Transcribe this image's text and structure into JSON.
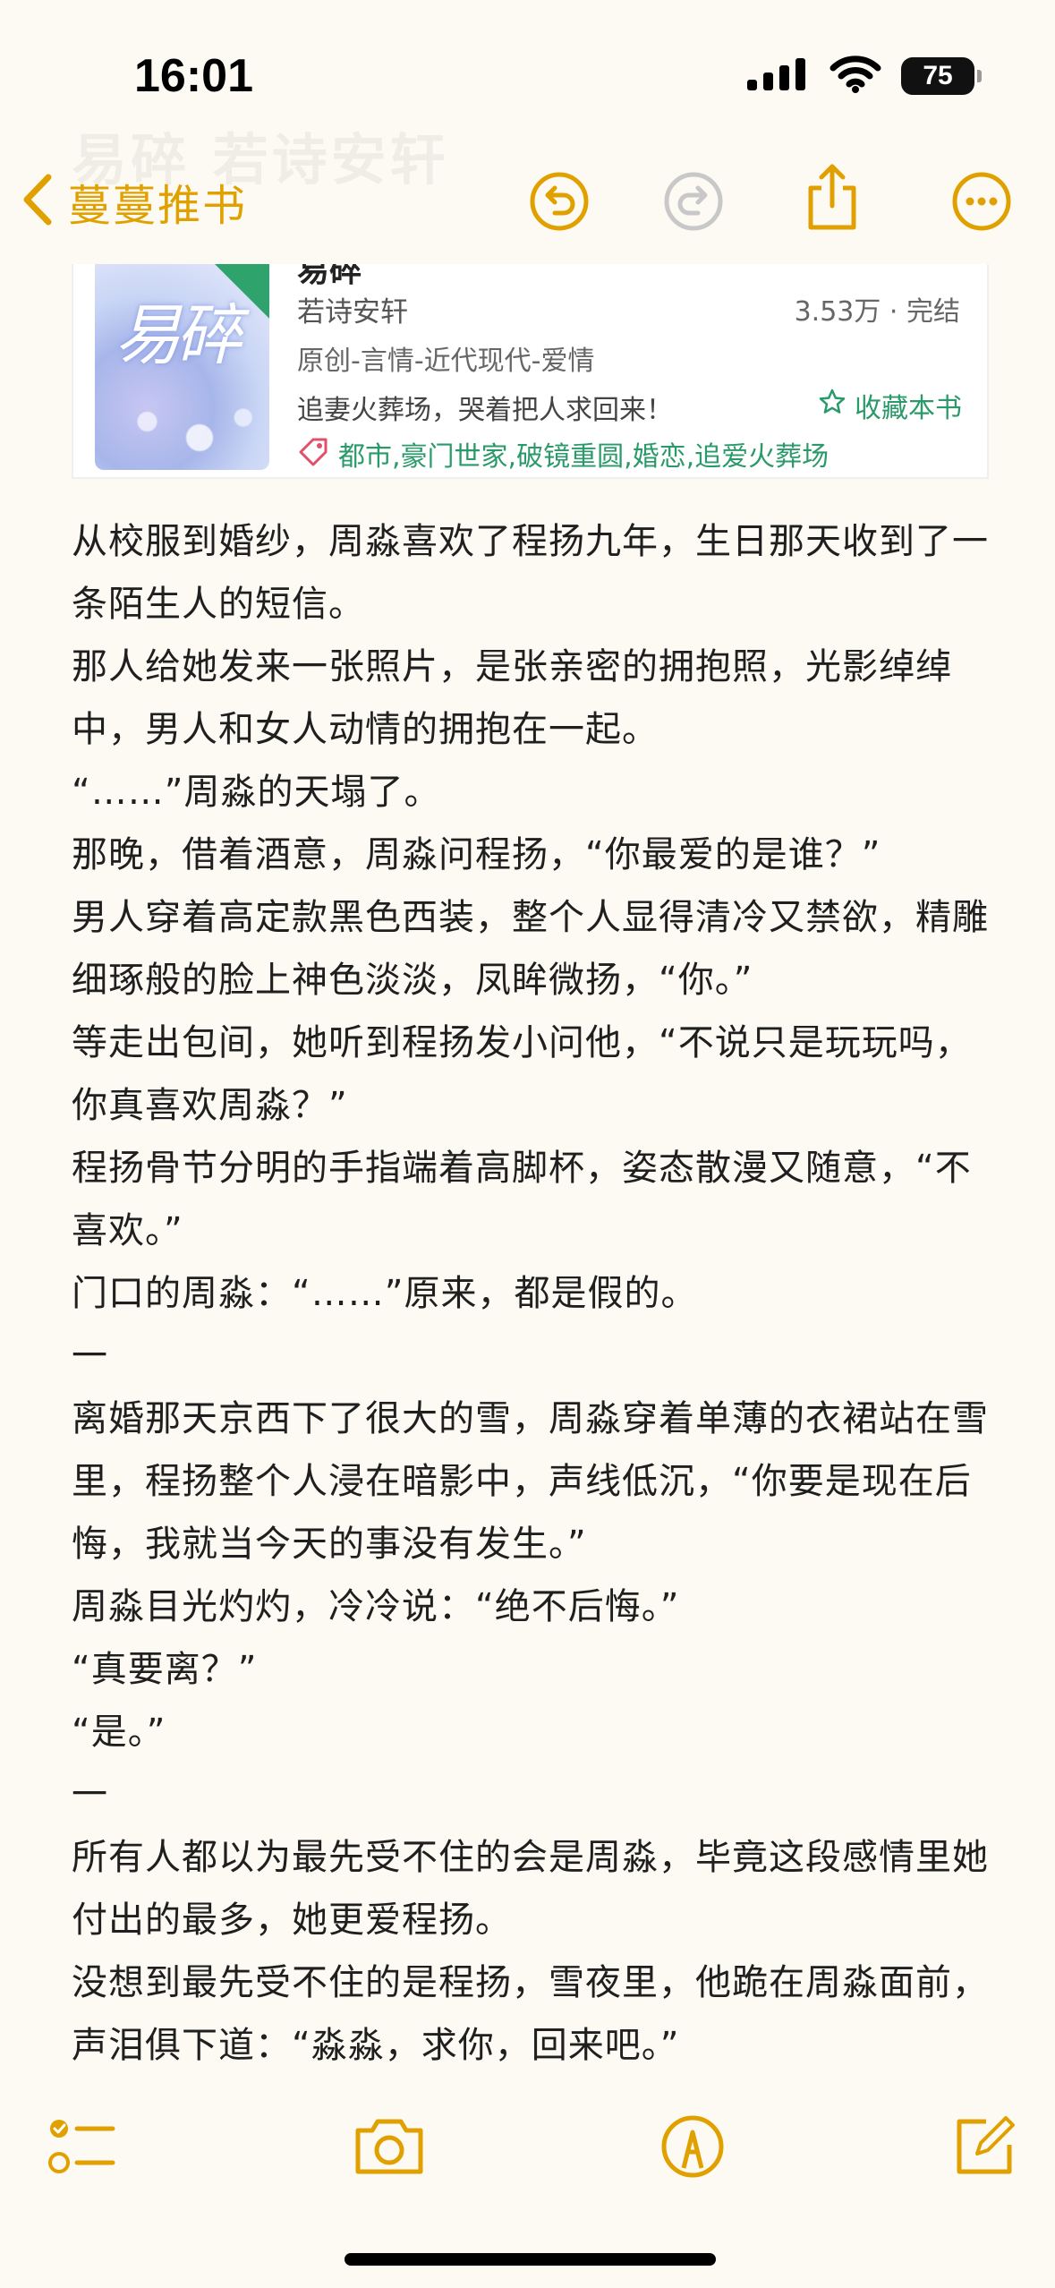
{
  "status_bar": {
    "time": "16:01",
    "battery": "75",
    "icons": [
      "signal-icon",
      "wifi-icon",
      "battery-icon"
    ]
  },
  "nav": {
    "back_label": "蔓蔓推书",
    "ghost_title": "易碎 若诗安轩",
    "accent_color": "#e0a100",
    "icons": [
      "undo-icon",
      "redo-icon",
      "share-icon",
      "more-icon"
    ]
  },
  "book": {
    "cut_title": "易碎",
    "cover_title": "易碎",
    "author": "若诗安轩",
    "stats": "3.53万 · 完结",
    "category": "原创-言情-近代现代-爱情",
    "slogan": "追妻火葬场，哭着把人求回来！",
    "collect_label": "收藏本书",
    "tags": "都市,豪门世家,破镜重圆,婚恋,追爱火葬场",
    "accent_color": "#2a9a6a"
  },
  "article": {
    "paragraphs": [
      "从校服到婚纱，周淼喜欢了程扬九年，生日那天收到了一条陌生人的短信。",
      "那人给她发来一张照片，是张亲密的拥抱照，光影绰绰中，男人和女人动情的拥抱在一起。",
      "“……”周淼的天塌了。",
      "那晚，借着酒意，周淼问程扬，“你最爱的是谁？”",
      "男人穿着高定款黑色西装，整个人显得清冷又禁欲，精雕细琢般的脸上神色淡淡，凤眸微扬，“你。”",
      "等走出包间，她听到程扬发小问他，“不说只是玩玩吗，你真喜欢周淼？”",
      "程扬骨节分明的手指端着高脚杯，姿态散漫又随意，“不喜欢。”",
      "门口的周淼：“……”原来，都是假的。",
      "一",
      "离婚那天京西下了很大的雪，周淼穿着单薄的衣裙站在雪里，程扬整个人浸在暗影中，声线低沉，“你要是现在后悔，我就当今天的事没有发生。”",
      "周淼目光灼灼，冷冷说：“绝不后悔。”",
      "“真要离？”",
      "“是。”",
      "一",
      "所有人都以为最先受不住的会是周淼，毕竟这段感情里她付出的最多，她更爱程扬。",
      "没想到最先受不住的是程扬，雪夜里，他跪在周淼面前，声泪俱下道：“淼淼，求你，回来吧。”"
    ]
  },
  "toolbar": {
    "icons": [
      "checklist-icon",
      "camera-icon",
      "markup-icon",
      "compose-icon"
    ]
  }
}
